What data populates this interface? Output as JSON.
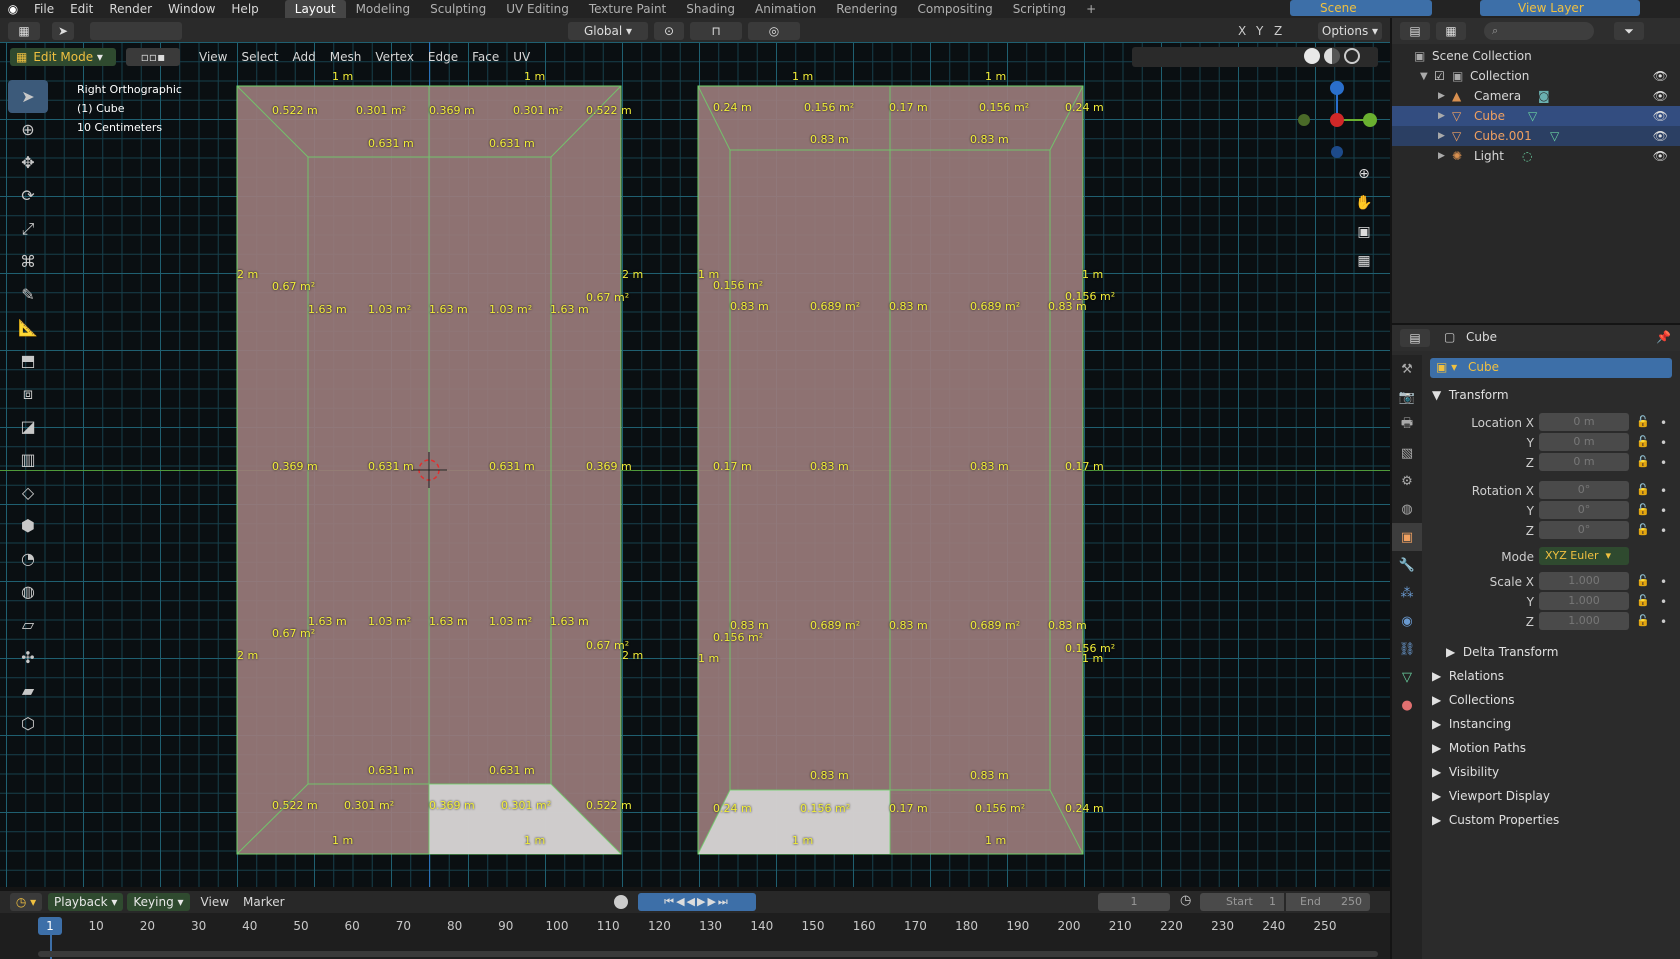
{
  "topbar": {
    "menus": [
      "File",
      "Edit",
      "Render",
      "Window",
      "Help"
    ],
    "workspaces": [
      "Layout",
      "Modeling",
      "Sculpting",
      "UV Editing",
      "Texture Paint",
      "Shading",
      "Animation",
      "Rendering",
      "Compositing",
      "Scripting"
    ],
    "active_workspace": "Layout",
    "scene": "Scene",
    "view_layer": "View Layer"
  },
  "viewport_header": {
    "mode": "Edit Mode",
    "menus": [
      "View",
      "Select",
      "Add",
      "Mesh",
      "Vertex",
      "Edge",
      "Face",
      "UV"
    ],
    "orientation": "Global",
    "options": "Options",
    "axes": [
      "X",
      "Y",
      "Z"
    ]
  },
  "viewport_info": {
    "view": "Right Orthographic",
    "object": "(1) Cube",
    "scale": "10 Centimeters"
  },
  "measurements_left": {
    "top_1m_a": "1 m",
    "top_1m_b": "1 m",
    "r1": [
      "0.522 m",
      "0.301 m²",
      "0.369 m",
      "0.301 m²",
      "0.522 m"
    ],
    "r2": [
      "0.631 m",
      "0.631 m"
    ],
    "side_2m": "2 m",
    "face_067": "0.67 m²",
    "r3": [
      "1.63 m",
      "1.03 m²",
      "1.63 m",
      "1.03 m²",
      "1.63 m"
    ],
    "mid": [
      "0.369 m",
      "0.631 m",
      "0.631 m",
      "0.369 m"
    ],
    "bottom_r": [
      "0.631 m",
      "0.631 m"
    ],
    "bottom_r1": [
      "0.522 m",
      "0.301 m²",
      "0.369 m",
      "0.301 m²",
      "0.522 m"
    ],
    "bot_1m": "1 m"
  },
  "measurements_right": {
    "top_1m": "1 m",
    "r1": [
      "0.24 m",
      "0.156 m²",
      "0.17 m",
      "0.156 m²",
      "0.24 m"
    ],
    "r2": [
      "0.83 m",
      "0.83 m"
    ],
    "side_1m": "1 m",
    "face_0156": "0.156 m²",
    "r3": [
      "0.83 m",
      "0.689 m²",
      "0.83 m",
      "0.689 m²",
      "0.83 m"
    ],
    "mid": [
      "0.17 m",
      "0.83 m",
      "0.83 m",
      "0.17 m"
    ]
  },
  "outliner": {
    "root": "Scene Collection",
    "collection": "Collection",
    "items": [
      "Camera",
      "Cube",
      "Cube.001",
      "Light"
    ]
  },
  "properties": {
    "object_name": "Cube",
    "datablock": "Cube",
    "transform_title": "Transform",
    "location_label": "Location X",
    "y": "Y",
    "z": "Z",
    "location_values": [
      "0 m",
      "0 m",
      "0 m"
    ],
    "rotation_label": "Rotation X",
    "rotation_values": [
      "0°",
      "0°",
      "0°"
    ],
    "mode_label": "Mode",
    "mode_value": "XYZ Euler",
    "scale_label": "Scale X",
    "scale_values": [
      "1.000",
      "1.000",
      "1.000"
    ],
    "delta": "Delta Transform",
    "panels": [
      "Relations",
      "Collections",
      "Instancing",
      "Motion Paths",
      "Visibility",
      "Viewport Display",
      "Custom Properties"
    ]
  },
  "timeline": {
    "menus": [
      "Playback",
      "Keying",
      "View",
      "Marker"
    ],
    "current_frame": "1",
    "start_label": "Start",
    "start": "1",
    "end_label": "End",
    "end": "250",
    "ticks": [
      "10",
      "20",
      "30",
      "40",
      "50",
      "60",
      "70",
      "80",
      "90",
      "100",
      "110",
      "120",
      "130",
      "140",
      "150",
      "160",
      "170",
      "180",
      "190",
      "200",
      "210",
      "220",
      "230",
      "240",
      "250"
    ]
  }
}
